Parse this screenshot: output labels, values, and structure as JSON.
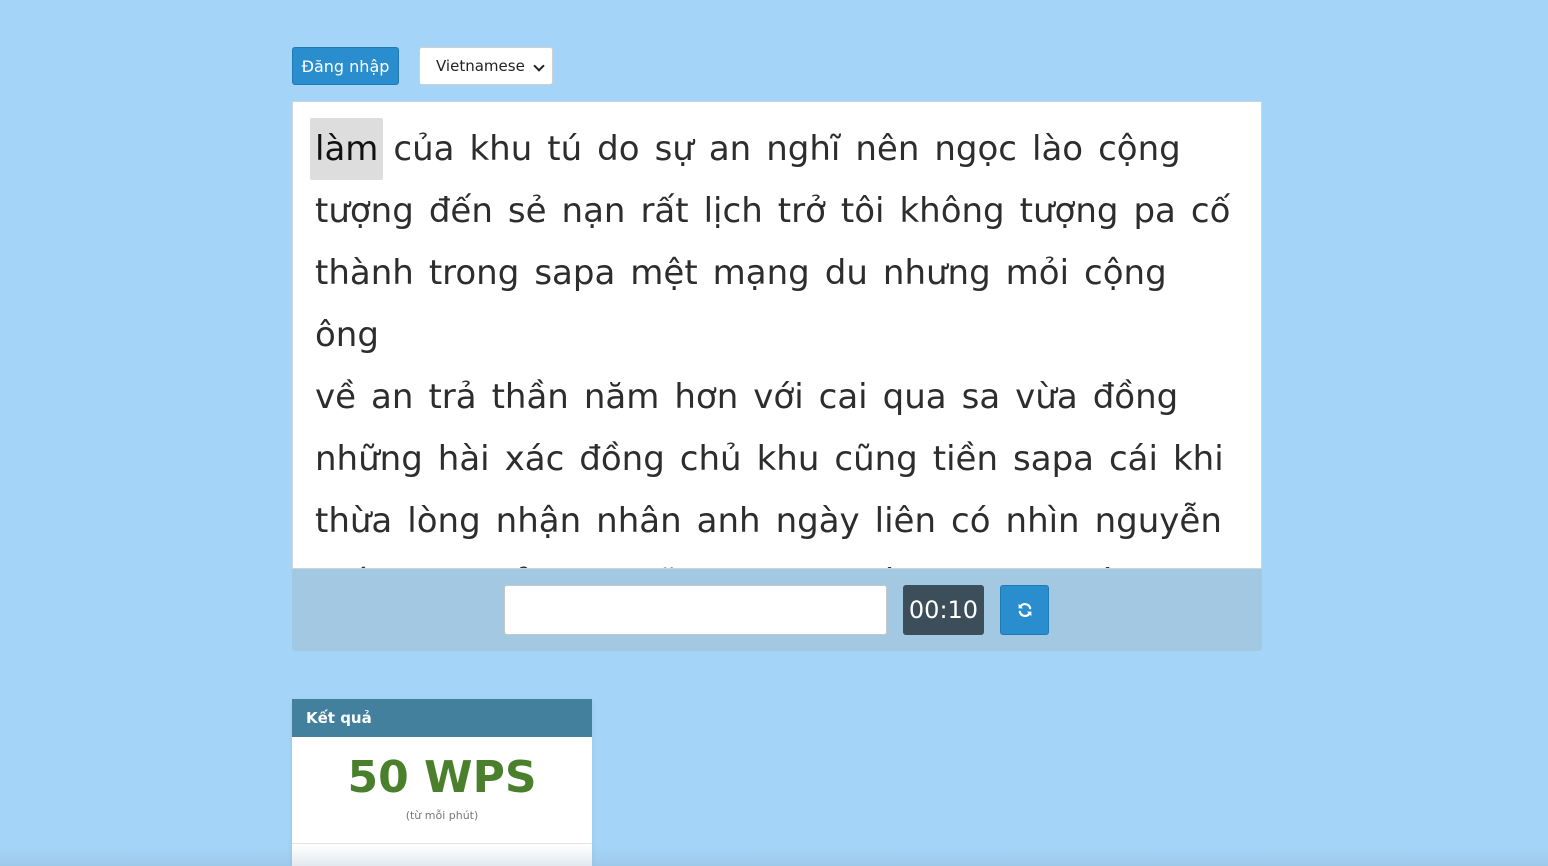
{
  "header": {
    "login_label": "Đăng nhập",
    "language_selected": "Vietnamese"
  },
  "typing_test": {
    "current_word_index": 0,
    "lines": [
      [
        "làm",
        "của",
        "khu",
        "tú",
        "do",
        "sự",
        "an",
        "nghĩ",
        "nên",
        "ngọc",
        "lào",
        "cộng"
      ],
      [
        "tượng",
        "đến",
        "sẻ",
        "nạn",
        "rất",
        "lịch",
        "trở",
        "tôi",
        "không",
        "tượng",
        "pa",
        "cố"
      ],
      [
        "thành",
        "trong",
        "sapa",
        "mệt",
        "mạng",
        "du",
        "nhưng",
        "mỏi",
        "cộng",
        "ông"
      ],
      [
        "về",
        "an",
        "trả",
        "thần",
        "năm",
        "hơn",
        "với",
        "cai",
        "qua",
        "sa",
        "vừa",
        "đồng"
      ],
      [
        "những",
        "hài",
        "xác",
        "đồng",
        "chủ",
        "khu",
        "cũng",
        "tiền",
        "sapa",
        "cái",
        "khi"
      ],
      [
        "thừa",
        "lòng",
        "nhận",
        "nhân",
        "anh",
        "ngày",
        "liên",
        "có",
        "nhìn",
        "nguyễn"
      ],
      [
        "chính",
        "tự",
        "chủ",
        "chia",
        "nữ",
        "zing",
        "qua",
        "đông",
        "quan",
        "thứ",
        "mạng"
      ]
    ],
    "input_value": "",
    "timer": "00:10",
    "refresh_icon": "refresh-icon"
  },
  "result": {
    "title": "Kết quả",
    "wps": "50 WPS",
    "wps_subtitle": "(từ mỗi phút)"
  },
  "colors": {
    "background": "#a4d5f9",
    "primary_button": "#2a8dce",
    "timer_bg": "#3c4e5a",
    "result_header": "#42809e",
    "wps_green": "#4a7f2b"
  }
}
